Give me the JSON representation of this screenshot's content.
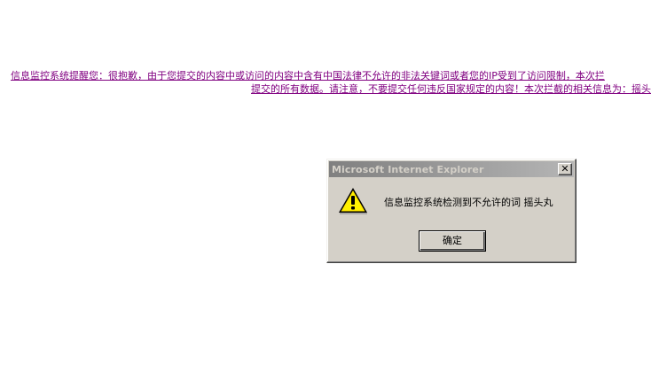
{
  "notice": {
    "line1": "信息监控系统提醒您：很抱歉，由于您提交的内容中或访问的内容中含有中国法律不允许的非法关键词或者您的IP受到了访问限制，本次拦",
    "line2": "提交的所有数据。请注意，不要提交任何违反国家规定的内容！本次拦截的相关信息为：摇头"
  },
  "dialog": {
    "title": "Microsoft Internet Explorer",
    "close_glyph": "✕",
    "icon": "warning-icon",
    "message": "信息监控系统检测到不允许的词 摇头丸",
    "ok_label": "确定"
  },
  "colors": {
    "link_visited": "#800080",
    "dialog_face": "#d4d0c8",
    "titlebar_inactive": "#808080"
  }
}
